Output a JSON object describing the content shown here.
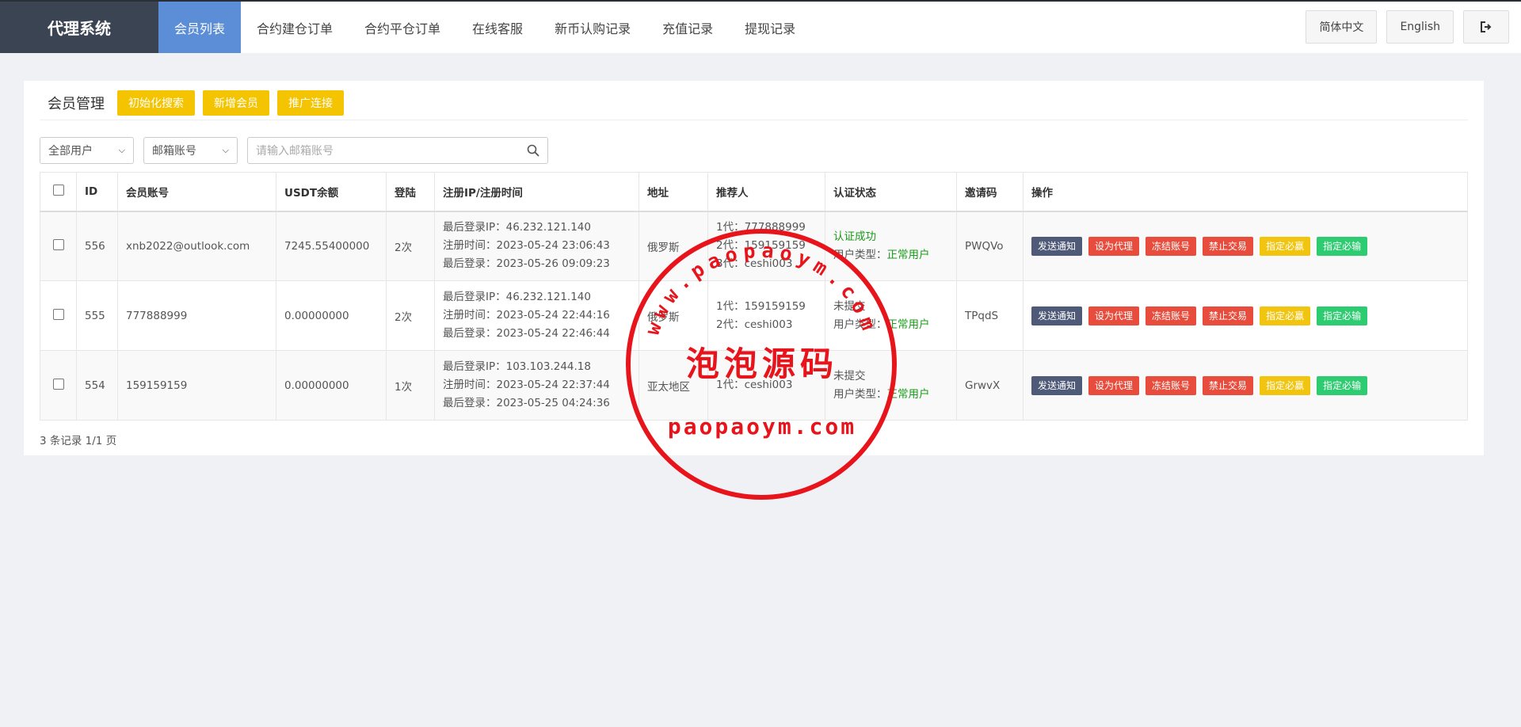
{
  "header": {
    "brand": "代理系统",
    "nav": [
      "会员列表",
      "合约建仓订单",
      "合约平仓订单",
      "在线客服",
      "新币认购记录",
      "充值记录",
      "提现记录"
    ],
    "lang_zh": "简体中文",
    "lang_en": "English",
    "logout_icon": "logout-icon"
  },
  "panel": {
    "title": "会员管理",
    "btn_reset": "初始化搜索",
    "btn_add": "新增会员",
    "btn_promo": "推广连接",
    "filter_user_type": "全部用户",
    "filter_field": "邮箱账号",
    "search_placeholder": "请输入邮箱账号"
  },
  "table": {
    "headers": [
      "ID",
      "会员账号",
      "USDT余额",
      "登陆",
      "注册IP/注册时间",
      "地址",
      "推荐人",
      "认证状态",
      "邀请码",
      "操作"
    ],
    "actions": [
      "发送通知",
      "设为代理",
      "冻结账号",
      "禁止交易",
      "指定必赢",
      "指定必输"
    ],
    "rows": [
      {
        "id": "556",
        "account": "xnb2022@outlook.com",
        "balance": "7245.55400000",
        "logins": "2次",
        "ip": "最后登录IP：46.232.121.140",
        "reg": "注册时间：2023-05-24 23:06:43",
        "last": "最后登录：2023-05-26 09:09:23",
        "addr": "俄罗斯",
        "ref": [
          "1代：777888999",
          "2代：159159159",
          "3代：ceshi003"
        ],
        "auth": "认证成功",
        "user_type_label": "用户类型：",
        "user_type": "正常用户",
        "invite": "PWQVo"
      },
      {
        "id": "555",
        "account": "777888999",
        "balance": "0.00000000",
        "logins": "2次",
        "ip": "最后登录IP：46.232.121.140",
        "reg": "注册时间：2023-05-24 22:44:16",
        "last": "最后登录：2023-05-24 22:46:44",
        "addr": "俄罗斯",
        "ref": [
          "1代：159159159",
          "2代：ceshi003"
        ],
        "auth": "未提交",
        "user_type_label": "用户类型：",
        "user_type": "正常用户",
        "invite": "TPqdS"
      },
      {
        "id": "554",
        "account": "159159159",
        "balance": "0.00000000",
        "logins": "1次",
        "ip": "最后登录IP：103.103.244.18",
        "reg": "注册时间：2023-05-24 22:37:44",
        "last": "最后登录：2023-05-25 04:24:36",
        "addr": "亚太地区",
        "ref": [
          "1代：ceshi003"
        ],
        "auth": "未提交",
        "user_type_label": "用户类型：",
        "user_type": "正常用户",
        "invite": "GrwvX"
      }
    ],
    "footer": "3 条记录 1/1 页"
  },
  "watermark": {
    "top_arc": "www.paopaoym.com",
    "center": "泡泡源码",
    "bottom": "paopaoym.com",
    "color": "#e8141b"
  }
}
